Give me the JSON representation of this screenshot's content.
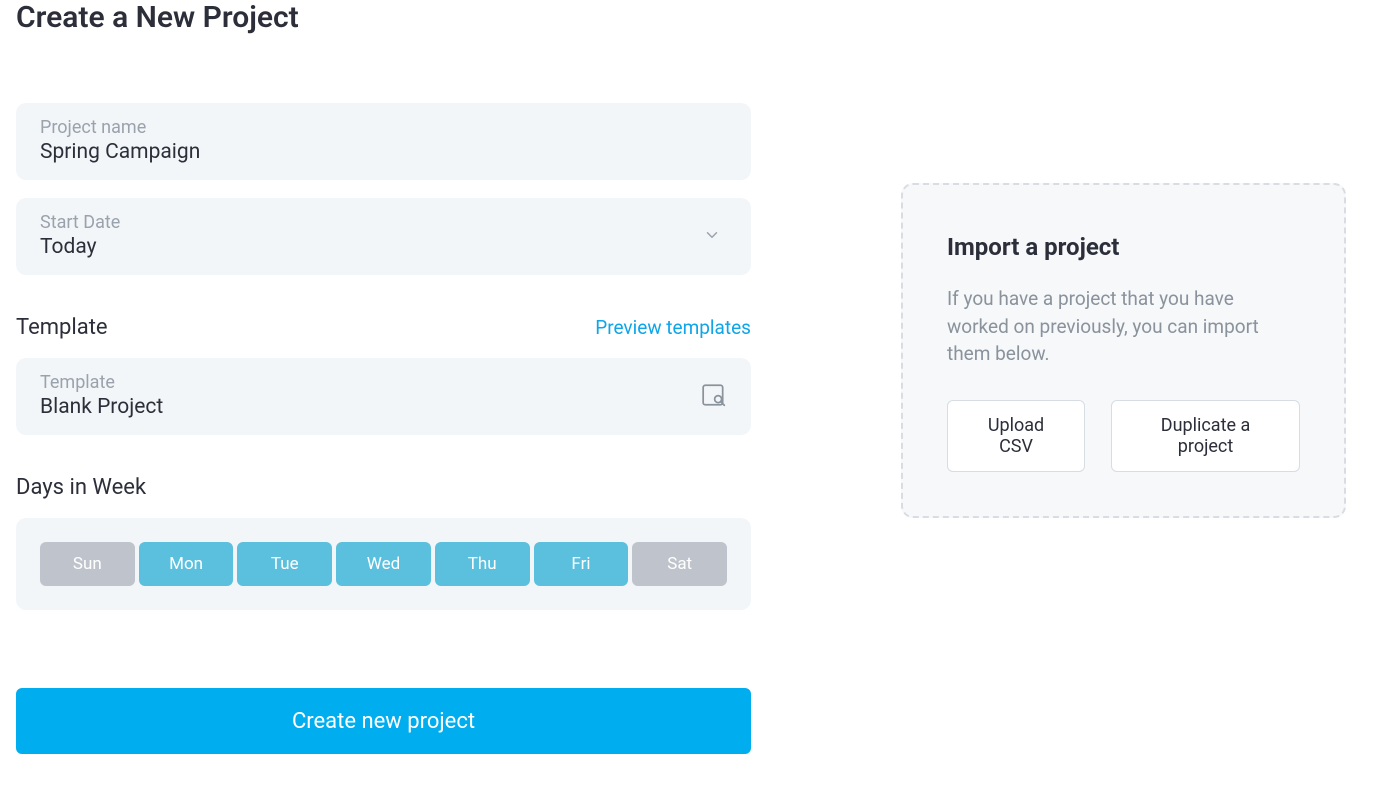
{
  "page_title": "Create a New Project",
  "project_name": {
    "label": "Project name",
    "value": "Spring Campaign"
  },
  "start_date": {
    "label": "Start Date",
    "value": "Today"
  },
  "template_section": {
    "heading": "Template",
    "preview_link": "Preview templates",
    "field_label": "Template",
    "value": "Blank Project"
  },
  "days_section": {
    "heading": "Days in Week",
    "days": [
      {
        "abbr": "Sun",
        "active": false
      },
      {
        "abbr": "Mon",
        "active": true
      },
      {
        "abbr": "Tue",
        "active": true
      },
      {
        "abbr": "Wed",
        "active": true
      },
      {
        "abbr": "Thu",
        "active": true
      },
      {
        "abbr": "Fri",
        "active": true
      },
      {
        "abbr": "Sat",
        "active": false
      }
    ]
  },
  "submit_label": "Create new project",
  "import_panel": {
    "title": "Import a project",
    "description": "If you have a project that you have worked on previously, you can import them below.",
    "upload_label": "Upload CSV",
    "duplicate_label": "Duplicate a project"
  }
}
